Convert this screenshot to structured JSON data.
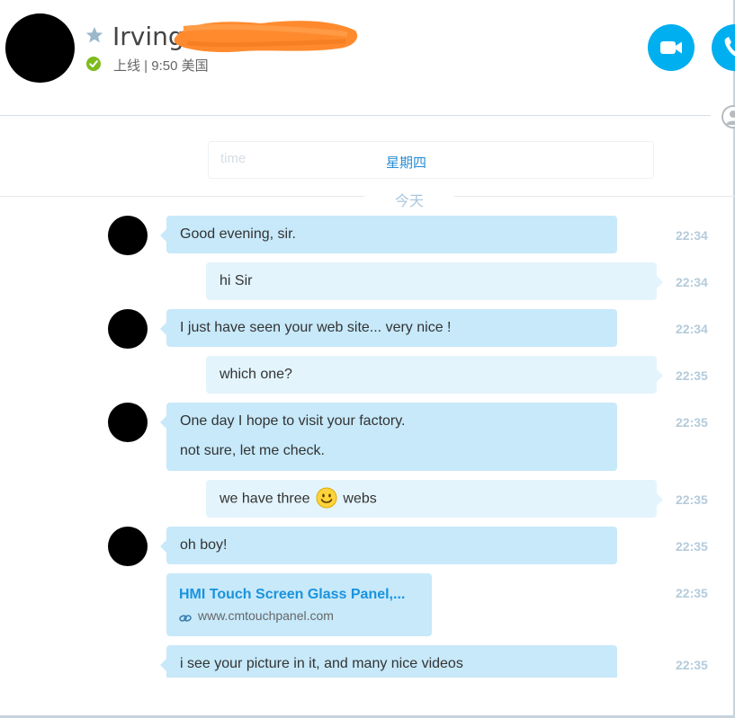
{
  "header": {
    "contact_name": "Irving",
    "status_text": "上线 | 9:50 美国"
  },
  "history": {
    "ghost_label": "time",
    "previous_day": "星期四",
    "today": "今天"
  },
  "messages": [
    {
      "lines": [
        "Good evening, sir."
      ],
      "time": "22:34"
    },
    {
      "lines": [
        "hi Sir"
      ],
      "time": "22:34"
    },
    {
      "lines": [
        "I just have seen your web site... very nice !"
      ],
      "time": "22:34"
    },
    {
      "lines": [
        "which one?"
      ],
      "time": "22:35"
    },
    {
      "lines": [
        "One day I hope to visit your factory.",
        "not sure, let me check."
      ],
      "time": "22:35"
    },
    {
      "lines": [
        "we have three",
        "webs"
      ],
      "emoticon": "smile-icon",
      "time": "22:35"
    },
    {
      "lines": [
        "oh boy!"
      ],
      "time": "22:35"
    },
    {
      "link_title": "HMI Touch Screen Glass Panel,...",
      "link_url": "www.cmtouchpanel.com",
      "time": "22:35"
    },
    {
      "lines": [
        "i see your picture in it, and many nice videos"
      ],
      "time": "22:35"
    }
  ],
  "icons": {
    "favorite": "star-icon",
    "status": "check-icon",
    "video_call": "video-camera-icon",
    "audio_call": "phone-icon",
    "link": "link-icon",
    "add_contact": "add-person-icon"
  },
  "colors": {
    "accent": "#00aff0",
    "incoming_bubble": "#c7e9fa",
    "outgoing_bubble": "#e3f4fc",
    "online_status": "#7dbb1d",
    "link_text": "#1a93dd",
    "timestamp": "#b4cbdb",
    "redaction": "#ff8a2e"
  }
}
